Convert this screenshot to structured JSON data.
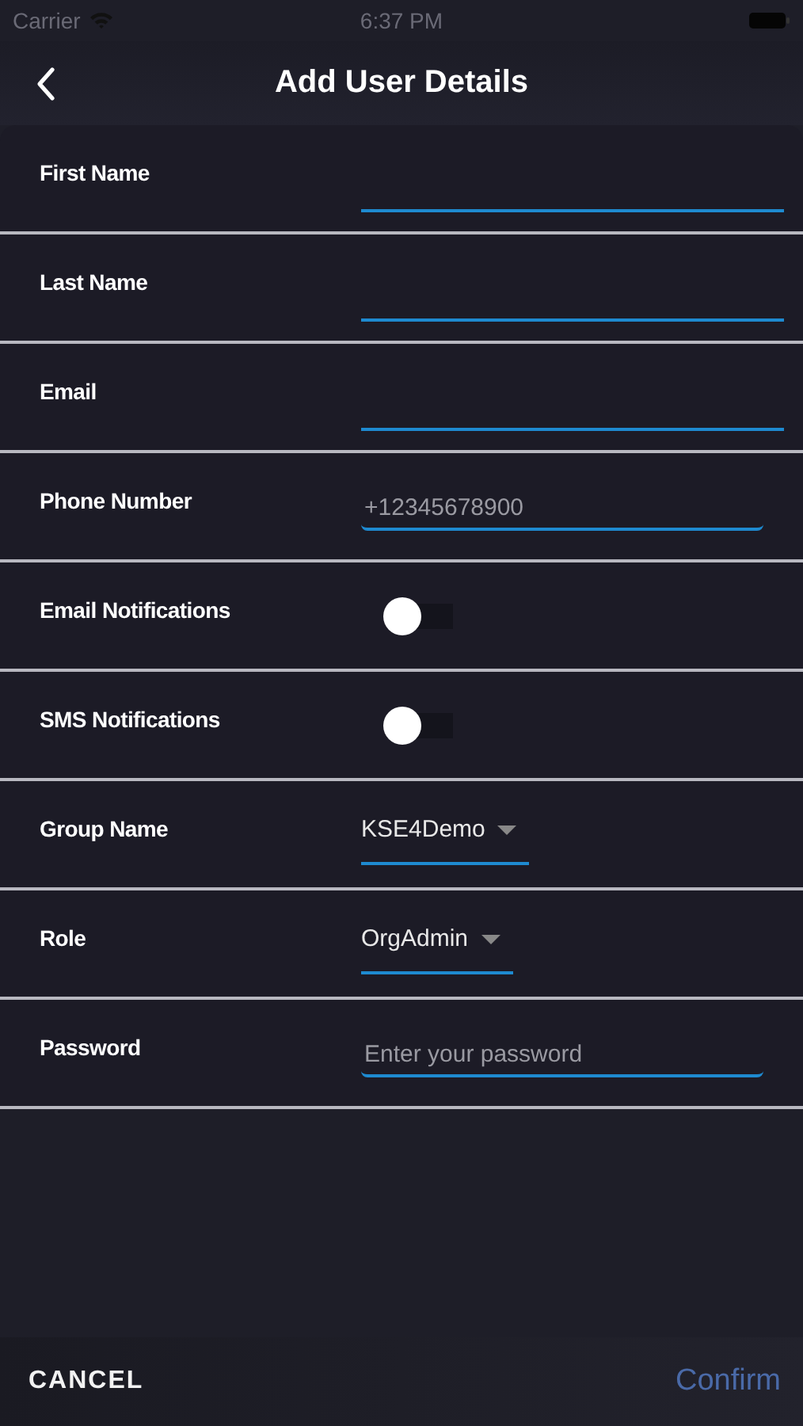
{
  "status_bar": {
    "carrier": "Carrier",
    "time": "6:37 PM"
  },
  "header": {
    "title": "Add User Details"
  },
  "fields": [
    {
      "kind": "text",
      "label": "First Name"
    },
    {
      "kind": "text",
      "label": "Last Name"
    },
    {
      "kind": "text",
      "label": "Email"
    },
    {
      "kind": "text",
      "label": "Phone Number",
      "placeholder": "+12345678900"
    },
    {
      "kind": "toggle",
      "label": "Email Notifications",
      "on": false
    },
    {
      "kind": "toggle",
      "label": "SMS Notifications",
      "on": false
    },
    {
      "kind": "dropdown",
      "label": "Group Name",
      "value": "KSE4Demo"
    },
    {
      "kind": "dropdown",
      "label": "Role",
      "value": "OrgAdmin"
    },
    {
      "kind": "text",
      "label": "Password",
      "placeholder": "Enter your password"
    }
  ],
  "footer": {
    "cancel": "CANCEL",
    "confirm": {
      "label": "Confirm",
      "disabled": true
    }
  }
}
